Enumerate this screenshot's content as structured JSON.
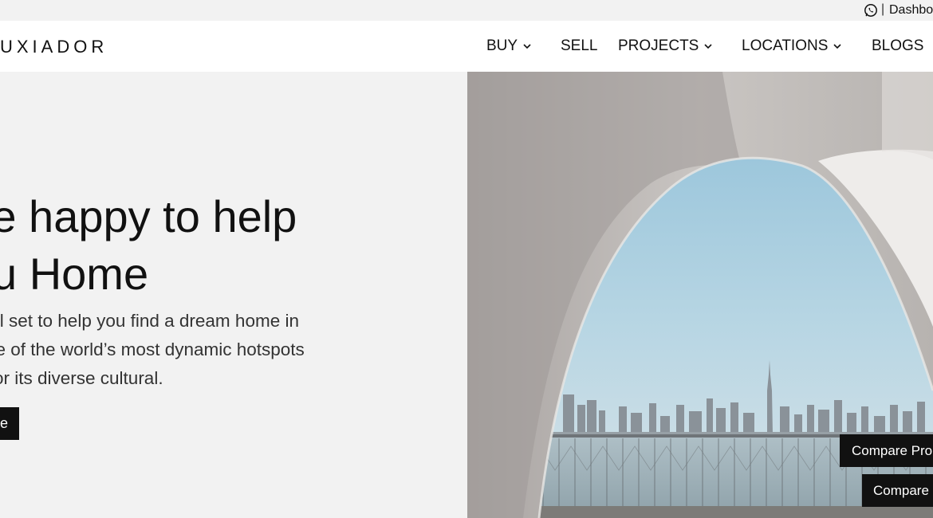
{
  "topbar": {
    "whatsapp_icon": "whatsapp-icon",
    "separator": "|",
    "dashboard_label": "Dashbo"
  },
  "nav": {
    "logo": "UXIADOR",
    "items": [
      {
        "label": "BUY",
        "has_dropdown": true
      },
      {
        "label": "SELL",
        "has_dropdown": false
      },
      {
        "label": "PROJECTS",
        "has_dropdown": true
      },
      {
        "label": "LOCATIONS",
        "has_dropdown": true
      },
      {
        "label": "BLOGS",
        "has_dropdown": false
      }
    ]
  },
  "hero": {
    "headline_line1": "'re happy to help",
    "headline_line2": "u Home",
    "sub_line1": "r is all set to help you find a dream home in",
    "sub_line2": "ne of the world’s most dynamic hotspots",
    "sub_line3": "or its diverse cultural.",
    "cta_label": "e",
    "image_alt": "Dubai skyline framed by white arch"
  },
  "floating": {
    "compare_properties_label": "Compare Pro",
    "compare_label": "Compare"
  },
  "colors": {
    "background": "#f2f2f2",
    "nav_background": "#ffffff",
    "text": "#111111",
    "button": "#111111",
    "sky": "#a9cde0"
  }
}
